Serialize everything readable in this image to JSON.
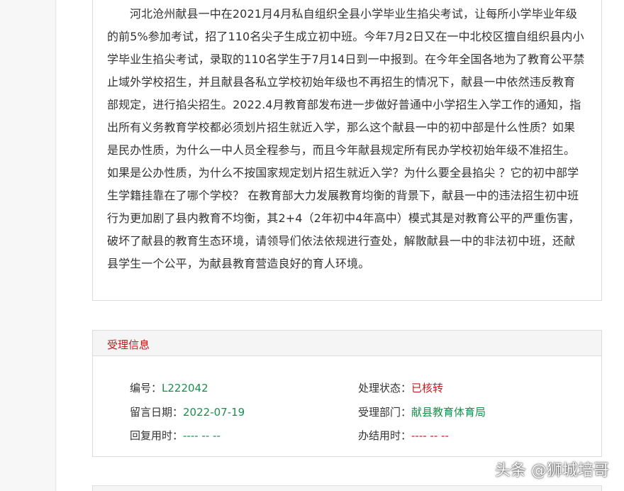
{
  "complaint": {
    "body": "河北沧州献县一中在2021月4月私自组织全县小学毕业生掐尖考试，让每所小学毕业年级的前5%参加考试，招了110名尖子生成立初中班。今年7月2日又在一中北校区擅自组织县内小学毕业生掐尖考试，录取的110名学生于7月14日到一中报到。在今年全国各地为了教育公平禁止域外学校招生，并且献县各私立学校初始年级也不再招生的情况下，献县一中依然违反教育部规定，进行掐尖招生。2022.4月教育部发布进一步做好普通中小学招生入学工作的通知，指出所有义务教育学校都必须划片招生就近入学，那么这个献县一中的初中部是什么性质？如果是民办性质，为什么一中人员全程参与，而且今年献县规定所有民办学校初始年级不准招生。如果是公办性质，为什么不按国家规定划片招生就近入学？为什么要全县掐尖 ？它的初中部学生学籍挂靠在了哪个学校？ 在教育部大力发展教育均衡的背景下，献县一中的违法招生初中班行为更加剧了县内教育不均衡，其2+4（2年初中4年高中）模式其是对教育公平的严重伤害，破坏了献县的教育生态环境，请领导们依法依规进行查处，解散献县一中的非法初中班，还献县学生一个公平，为献县教育营造良好的育人环境。"
  },
  "info": {
    "title": "受理信息",
    "number_label": "编号：",
    "number_value": "L222042",
    "status_label": "处理状态：",
    "status_value": "已核转",
    "date_label": "留言日期：",
    "date_value": "2022-07-19",
    "dept_label": "受理部门：",
    "dept_value": "献县教育体育局",
    "reply_label": "回复用时：",
    "reply_value": "---- -- --",
    "finish_label": "办结用时：",
    "finish_value": "---- -- --"
  },
  "watermark": "头条 @狮城培哥",
  "colors": {
    "accent_red": "#c8191e",
    "value_green": "#1a8f4c",
    "border": "#dcdcdc",
    "header_bg": "#f5f5f5"
  }
}
